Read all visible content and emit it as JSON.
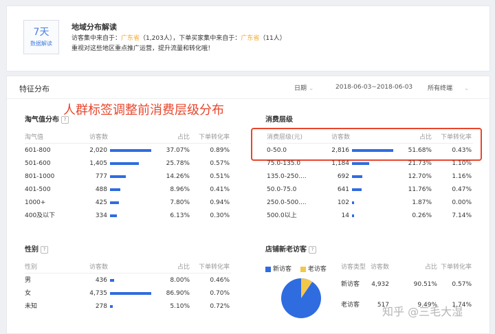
{
  "colors": {
    "accent": "#2f6ce0",
    "orange": "#f5a623",
    "annotation": "#e8452c",
    "yellow": "#f2c84b"
  },
  "region": {
    "days": "7天",
    "days_label": "数据解读",
    "title": "地域分布解读",
    "line1_a": "访客集中来自于：",
    "line1_b": "广东省",
    "line1_c": "（1,203人），下单买家集中来自于：",
    "line1_d": "广东省",
    "line1_e": "（11人）",
    "line2": "重视对这些地区重点推广运营，提升流量和转化哦！"
  },
  "feature": {
    "title": "特征分布",
    "date_label": "日期",
    "date_range": "2018-06-03~2018-06-03",
    "terminal": "所有终端",
    "annotation": "人群标签调整前消费层级分布"
  },
  "taoqi": {
    "title": "淘气值分布",
    "headers": [
      "淘气值",
      "访客数",
      "占比",
      "下单转化率"
    ],
    "rows": [
      {
        "label": "601-800",
        "visitors": "2,020",
        "share": "37.07%",
        "conv": "0.89%",
        "pct": 37.07
      },
      {
        "label": "501-600",
        "visitors": "1,405",
        "share": "25.78%",
        "conv": "0.57%",
        "pct": 25.78
      },
      {
        "label": "801-1000",
        "visitors": "777",
        "share": "14.26%",
        "conv": "0.51%",
        "pct": 14.26
      },
      {
        "label": "401-500",
        "visitors": "488",
        "share": "8.96%",
        "conv": "0.41%",
        "pct": 8.96
      },
      {
        "label": "1000+",
        "visitors": "425",
        "share": "7.80%",
        "conv": "0.94%",
        "pct": 7.8
      },
      {
        "label": "400及以下",
        "visitors": "334",
        "share": "6.13%",
        "conv": "0.30%",
        "pct": 6.13
      }
    ]
  },
  "consume": {
    "title": "消费层级",
    "headers": [
      "消费层级(元)",
      "访客数",
      "占比",
      "下单转化率"
    ],
    "rows": [
      {
        "label": "0-50.0",
        "visitors": "2,816",
        "share": "51.68%",
        "conv": "0.43%",
        "pct": 51.68
      },
      {
        "label": "75.0-135.0",
        "visitors": "1,184",
        "share": "21.73%",
        "conv": "1.10%",
        "pct": 21.73
      },
      {
        "label": "135.0-250....",
        "visitors": "692",
        "share": "12.70%",
        "conv": "1.16%",
        "pct": 12.7
      },
      {
        "label": "50.0-75.0",
        "visitors": "641",
        "share": "11.76%",
        "conv": "0.47%",
        "pct": 11.76
      },
      {
        "label": "250.0-500....",
        "visitors": "102",
        "share": "1.87%",
        "conv": "0.00%",
        "pct": 1.87
      },
      {
        "label": "500.0以上",
        "visitors": "14",
        "share": "0.26%",
        "conv": "7.14%",
        "pct": 0.26
      }
    ]
  },
  "gender": {
    "title": "性别",
    "headers": [
      "性别",
      "访客数",
      "占比",
      "下单转化率"
    ],
    "rows": [
      {
        "label": "男",
        "visitors": "436",
        "share": "8.00%",
        "conv": "0.46%",
        "pct": 8.0
      },
      {
        "label": "女",
        "visitors": "4,735",
        "share": "86.90%",
        "conv": "0.70%",
        "pct": 86.9
      },
      {
        "label": "未知",
        "visitors": "278",
        "share": "5.10%",
        "conv": "0.72%",
        "pct": 5.1
      }
    ]
  },
  "shop": {
    "title": "店铺新老访客",
    "legend_new": "新访客",
    "legend_old": "老访客",
    "headers": [
      "访客类型",
      "访客数",
      "占比",
      "下单转化率"
    ],
    "rows": [
      {
        "label": "新访客",
        "visitors": "4,932",
        "share": "90.51%",
        "conv": "0.57%"
      },
      {
        "label": "老访客",
        "visitors": "517",
        "share": "9.49%",
        "conv": "1.74%"
      }
    ],
    "pie_new_pct": 90.51
  },
  "watermark": "知乎 @三毛大湿"
}
